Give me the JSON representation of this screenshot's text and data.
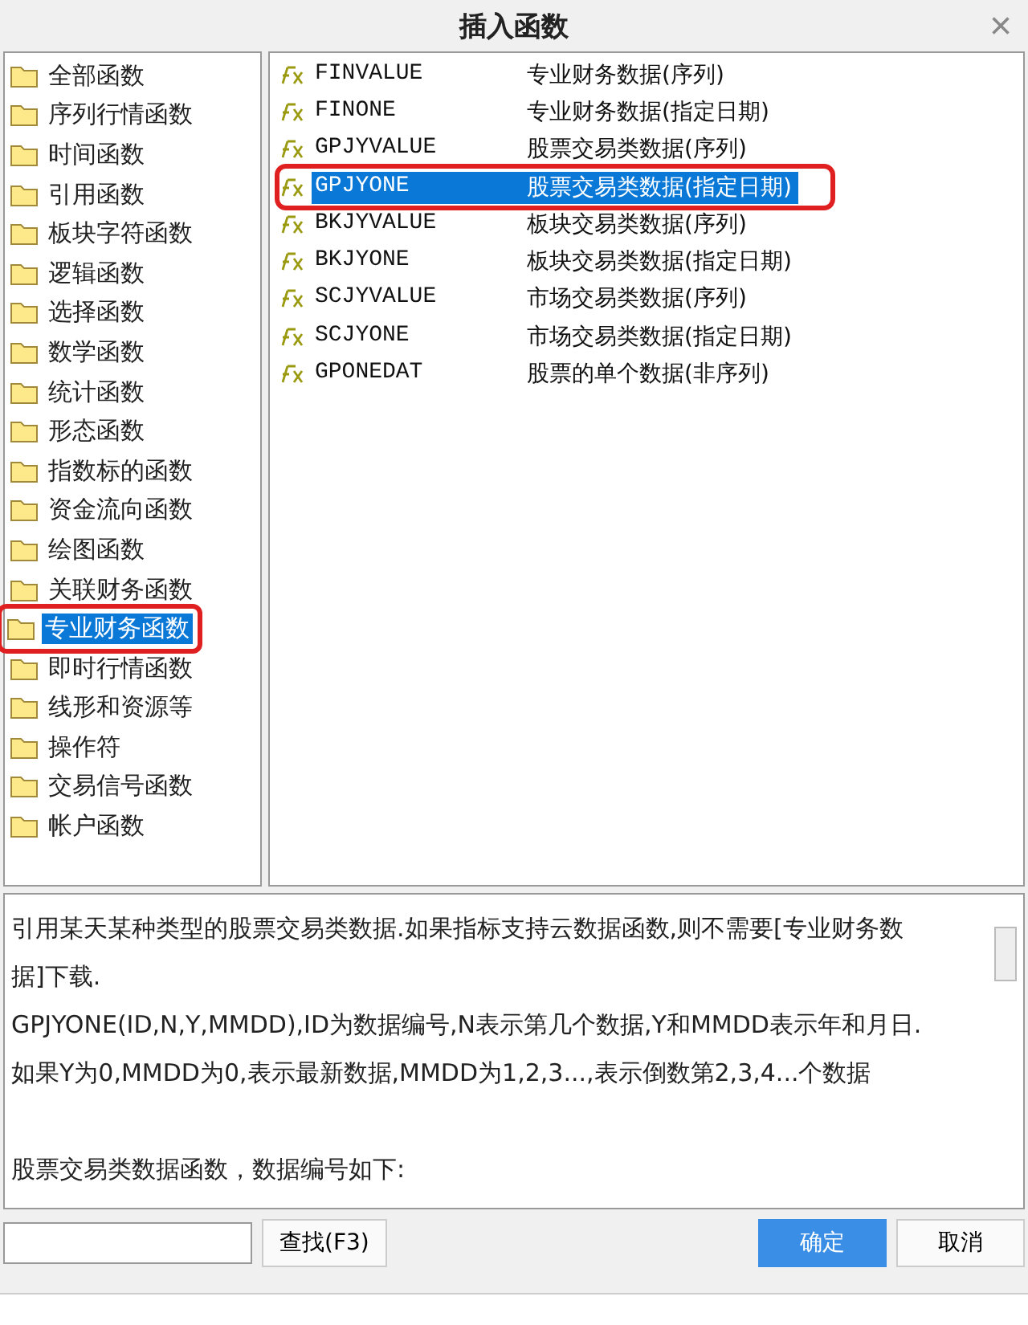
{
  "window": {
    "title": "插入函数",
    "close": "×"
  },
  "categories": [
    {
      "label": "全部函数",
      "selected": false,
      "annotated": false
    },
    {
      "label": "序列行情函数",
      "selected": false,
      "annotated": false
    },
    {
      "label": "时间函数",
      "selected": false,
      "annotated": false
    },
    {
      "label": "引用函数",
      "selected": false,
      "annotated": false
    },
    {
      "label": "板块字符函数",
      "selected": false,
      "annotated": false
    },
    {
      "label": "逻辑函数",
      "selected": false,
      "annotated": false
    },
    {
      "label": "选择函数",
      "selected": false,
      "annotated": false
    },
    {
      "label": "数学函数",
      "selected": false,
      "annotated": false
    },
    {
      "label": "统计函数",
      "selected": false,
      "annotated": false
    },
    {
      "label": "形态函数",
      "selected": false,
      "annotated": false
    },
    {
      "label": "指数标的函数",
      "selected": false,
      "annotated": false
    },
    {
      "label": "资金流向函数",
      "selected": false,
      "annotated": false
    },
    {
      "label": "绘图函数",
      "selected": false,
      "annotated": false
    },
    {
      "label": "关联财务函数",
      "selected": false,
      "annotated": false
    },
    {
      "label": "专业财务函数",
      "selected": true,
      "annotated": true
    },
    {
      "label": "即时行情函数",
      "selected": false,
      "annotated": false
    },
    {
      "label": "线形和资源等",
      "selected": false,
      "annotated": false
    },
    {
      "label": "操作符",
      "selected": false,
      "annotated": false
    },
    {
      "label": "交易信号函数",
      "selected": false,
      "annotated": false
    },
    {
      "label": "帐户函数",
      "selected": false,
      "annotated": false
    }
  ],
  "functions": [
    {
      "name": "FINVALUE",
      "description": "专业财务数据(序列)",
      "selected": false,
      "annotated": false
    },
    {
      "name": "FINONE",
      "description": "专业财务数据(指定日期)",
      "selected": false,
      "annotated": false
    },
    {
      "name": "GPJYVALUE",
      "description": "股票交易类数据(序列)",
      "selected": false,
      "annotated": false
    },
    {
      "name": "GPJYONE",
      "description": "股票交易类数据(指定日期)",
      "selected": true,
      "annotated": true
    },
    {
      "name": "BKJYVALUE",
      "description": "板块交易类数据(序列)",
      "selected": false,
      "annotated": false
    },
    {
      "name": "BKJYONE",
      "description": "板块交易类数据(指定日期)",
      "selected": false,
      "annotated": false
    },
    {
      "name": "SCJYVALUE",
      "description": "市场交易类数据(序列)",
      "selected": false,
      "annotated": false
    },
    {
      "name": "SCJYONE",
      "description": "市场交易类数据(指定日期)",
      "selected": false,
      "annotated": false
    },
    {
      "name": "GPONEDAT",
      "description": "股票的单个数据(非序列)",
      "selected": false,
      "annotated": false
    }
  ],
  "help_text": [
    "引用某天某种类型的股票交易类数据.如果指标支持云数据函数,则不需要[专业财务数据]下载.",
    "GPJYONE(ID,N,Y,MMDD),ID为数据编号,N表示第几个数据,Y和MMDD表示年和月日.",
    "如果Y为0,MMDD为0,表示最新数据,MMDD为1,2,3...,表示倒数第2,3,4...个数据"
  ],
  "help_section_heading": "股票交易类数据函数，数据编号如下:",
  "search_button": "查找(F3)",
  "ok_button": "确定",
  "cancel_button": "取消"
}
